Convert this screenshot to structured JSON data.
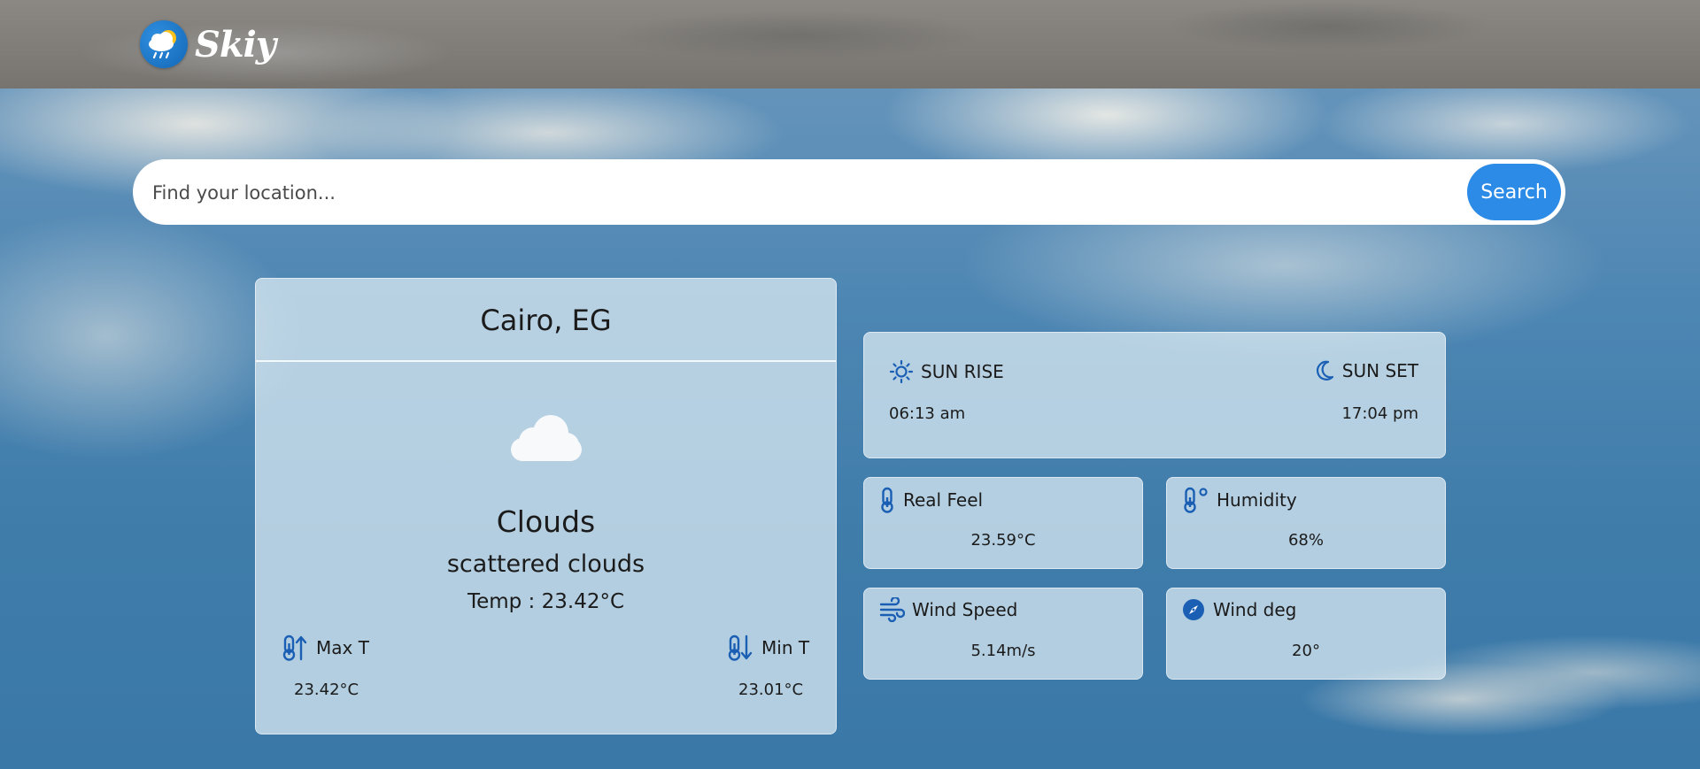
{
  "app": {
    "logo_text": "Skiy",
    "logo_icon": "rain-cloud-sun-icon"
  },
  "search": {
    "placeholder": "Find your location...",
    "value": "",
    "button_label": "Search"
  },
  "current": {
    "location": "Cairo, EG",
    "icon": "cloud-icon",
    "condition": "Clouds",
    "description": "scattered clouds",
    "temp_text": "Temp : 23.42°C",
    "max_label": "Max T",
    "max_value": "23.42°C",
    "min_label": "Min T",
    "min_value": "23.01°C"
  },
  "sun": {
    "sunrise_label": "SUN RISE",
    "sunrise_value": "06:13 am",
    "sunset_label": "SUN SET",
    "sunset_value": "17:04 pm"
  },
  "details": {
    "real_feel_label": "Real Feel",
    "real_feel_value": "23.59°C",
    "humidity_label": "Humidity",
    "humidity_value": "68%",
    "wind_speed_label": "Wind Speed",
    "wind_speed_value": "5.14m/s",
    "wind_deg_label": "Wind deg",
    "wind_deg_value": "20°"
  },
  "colors": {
    "accent": "#2b8be6",
    "icon_blue": "#1a5fb4",
    "card_bg": "#e1eef5"
  }
}
